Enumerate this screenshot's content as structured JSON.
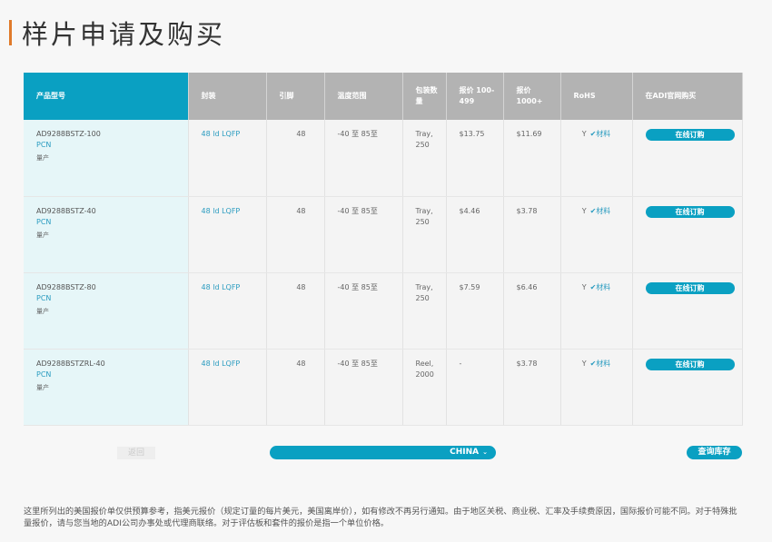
{
  "page": {
    "title": "样片申请及购买"
  },
  "table": {
    "headers": [
      "产品型号",
      "封装",
      "引脚",
      "温度范围",
      "包装数量",
      "报价 100-499",
      "报价 1000+",
      "RoHS",
      "在ADI官网购买"
    ],
    "rows": [
      {
        "model": "AD9288BSTZ-100",
        "pcn": "PCN",
        "status": "量产",
        "package": "48 ld LQFP",
        "pins": "48",
        "temp": "-40 至 85至",
        "packing": "Tray, 250",
        "price_100_499": "$13.75",
        "price_1000": "$11.69",
        "rohs": "Y",
        "material": "材料",
        "buy": "在线订购"
      },
      {
        "model": "AD9288BSTZ-40",
        "pcn": "PCN",
        "status": "量产",
        "package": "48 ld LQFP",
        "pins": "48",
        "temp": "-40 至 85至",
        "packing": "Tray, 250",
        "price_100_499": "$4.46",
        "price_1000": "$3.78",
        "rohs": "Y",
        "material": "材料",
        "buy": "在线订购"
      },
      {
        "model": "AD9288BSTZ-80",
        "pcn": "PCN",
        "status": "量产",
        "package": "48 ld LQFP",
        "pins": "48",
        "temp": "-40 至 85至",
        "packing": "Tray, 250",
        "price_100_499": "$7.59",
        "price_1000": "$6.46",
        "rohs": "Y",
        "material": "材料",
        "buy": "在线订购"
      },
      {
        "model": "AD9288BSTZRL-40",
        "pcn": "PCN",
        "status": "量产",
        "package": "48 ld LQFP",
        "pins": "48",
        "temp": "-40 至 85至",
        "packing": "Reel, 2000",
        "price_100_499": "-",
        "price_1000": "$3.78",
        "rohs": "Y",
        "material": "材料",
        "buy": "在线订购"
      }
    ]
  },
  "controls": {
    "back": "返回",
    "country": "CHINA",
    "inventory": "查询库存"
  },
  "footnote": "这里所列出的美国报价单仅供预算参考，指美元报价（规定订量的每片美元，美国离岸价），如有修改不再另行通知。由于地区关税、商业税、汇率及手续费原因，国际报价可能不同。对于特殊批量报价，请与您当地的ADI公司办事处或代理商联络。对于评估板和套件的报价是指一个单位价格。",
  "colors": {
    "accent": "#0aa0c2",
    "title_bar": "#e07a2a",
    "header_gray": "#b3b3b3"
  }
}
